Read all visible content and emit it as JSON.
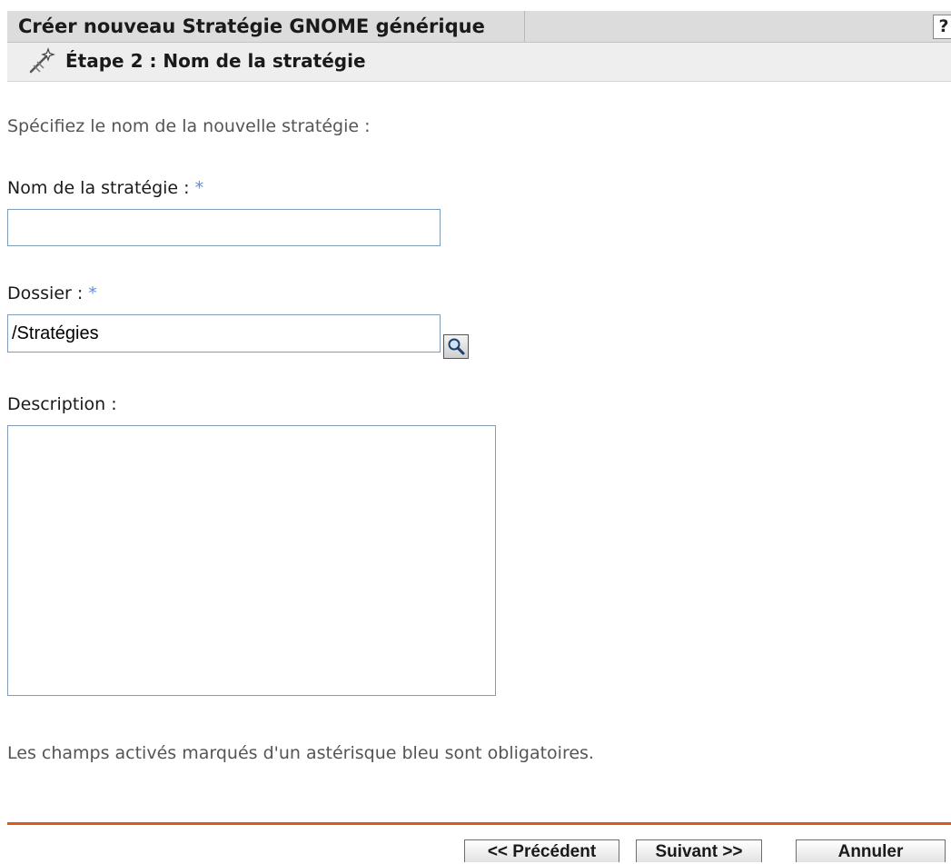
{
  "header": {
    "title": "Créer nouveau Stratégie GNOME générique",
    "help_label": "?"
  },
  "step": {
    "label": "Étape 2 : Nom de la stratégie",
    "icon": "wizard-wand-icon"
  },
  "intro_text": "Spécifiez le nom de la nouvelle stratégie :",
  "form": {
    "policy_name": {
      "label": "Nom de la stratégie :",
      "required_marker": "*",
      "value": ""
    },
    "folder": {
      "label": "Dossier :",
      "required_marker": "*",
      "value": "/Stratégies",
      "browse_icon": "magnifier-icon"
    },
    "description": {
      "label": "Description :",
      "value": ""
    }
  },
  "required_note": "Les champs activés marqués d'un astérisque bleu sont obligatoires.",
  "buttons": {
    "previous": "<< Précédent",
    "next": "Suivant >>",
    "cancel": "Annuler"
  },
  "colors": {
    "required_asterisk": "#5b8fd6",
    "divider": "#dd5a1f",
    "title_bar": "#dcdcdc",
    "step_bar": "#eeeeee",
    "input_border": "#7f9db9"
  }
}
